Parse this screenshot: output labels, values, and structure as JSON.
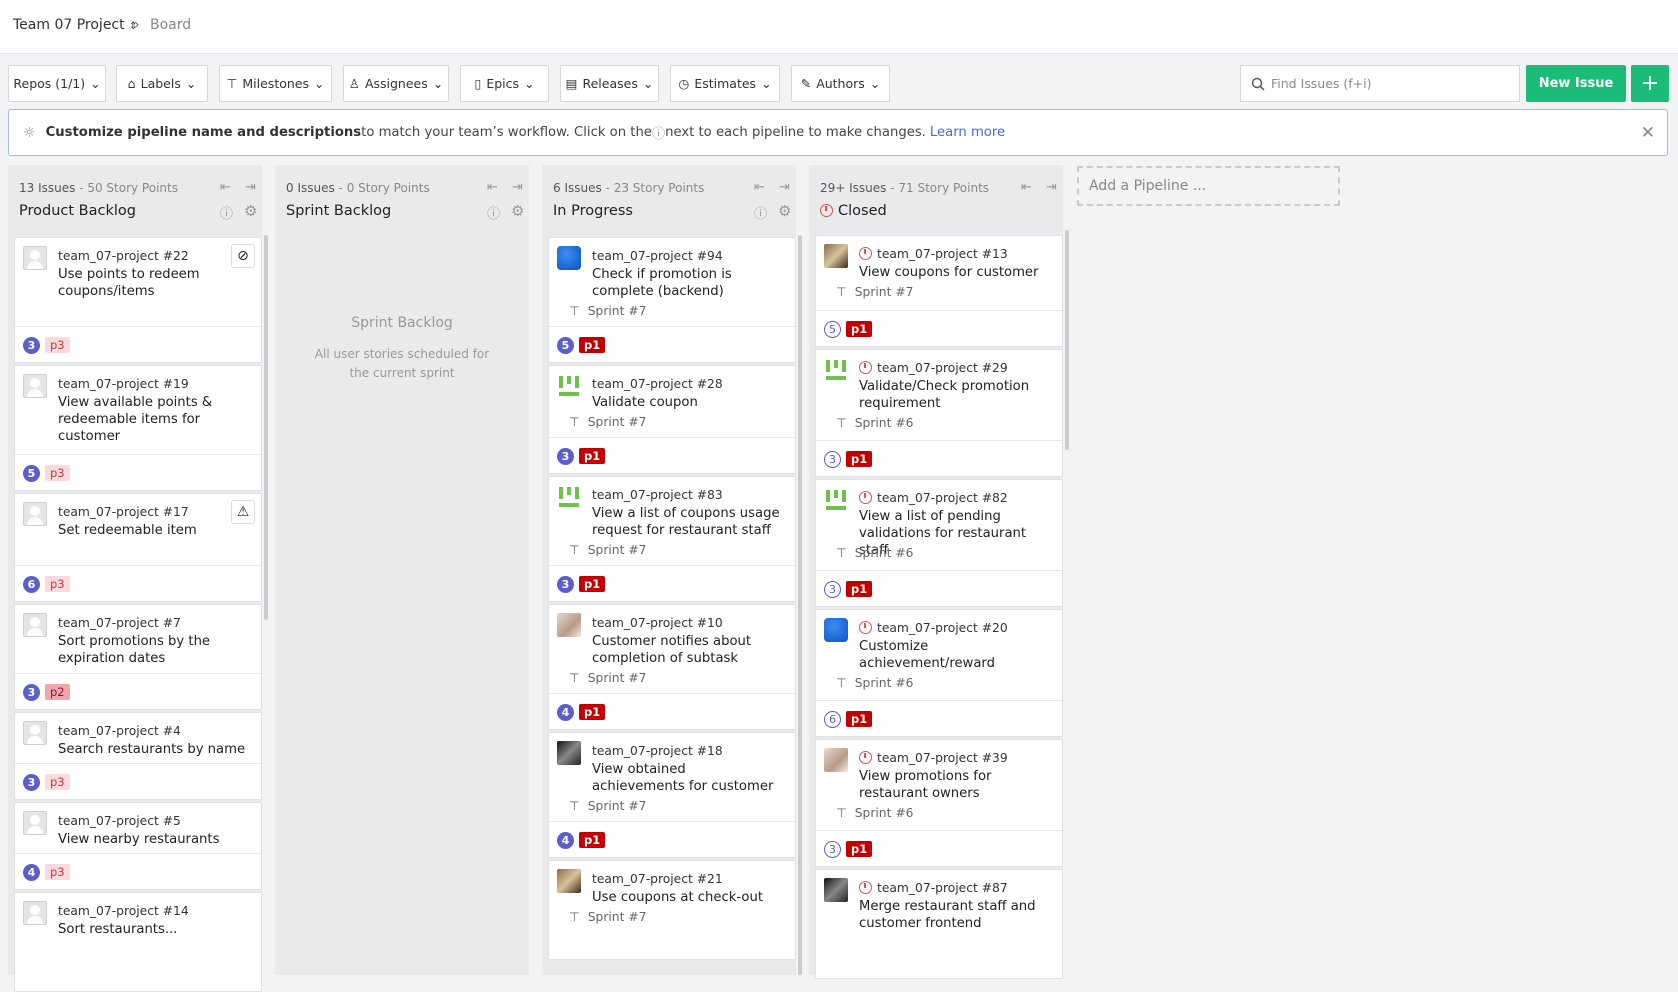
{
  "breadcrumb": {
    "project": "Team 07 Project",
    "page": "Board"
  },
  "toolbar": {
    "filters": [
      "Repos (1/1)",
      "Labels",
      "Milestones",
      "Assignees",
      "Epics",
      "Releases",
      "Estimates",
      "Authors"
    ],
    "search_placeholder": "Find Issues (f+i)",
    "new_issue": "New Issue",
    "plus": "+"
  },
  "banner": {
    "bold": "Customize pipeline name and descriptions",
    "text1": " to match your team’s workflow. Click on the ",
    "text2": " next to each pipeline to make changes.",
    "link": "Learn more"
  },
  "pipelines": [
    {
      "count": "13 Issues",
      "points": " - 50 Story Points",
      "name": "Product Backlog"
    },
    {
      "count": "0 Issues",
      "points": " - 0 Story Points",
      "name": "Sprint Backlog"
    },
    {
      "count": "6 Issues",
      "points": " - 23 Story Points",
      "name": "In Progress"
    },
    {
      "count": "29+ Issues",
      "points": " - 71 Story Points",
      "name": "Closed"
    }
  ],
  "sprint_backlog_empty": {
    "title": "Sprint Backlog",
    "desc": "All user stories scheduled for the current sprint"
  },
  "add_pipeline": "Add a Pipeline ...",
  "backlog_cards": [
    {
      "repo": "team_07-project #22",
      "title": "Use points to redeem coupons/items",
      "estimate": "3",
      "label": "p3"
    },
    {
      "repo": "team_07-project #19",
      "title": "View available points & redeemable items for customer",
      "estimate": "5",
      "label": "p3"
    },
    {
      "repo": "team_07-project #17",
      "title": "Set redeemable item",
      "estimate": "6",
      "label": "p3"
    },
    {
      "repo": "team_07-project #7",
      "title": "Sort promotions by the expiration dates",
      "estimate": "3",
      "label": "p2"
    },
    {
      "repo": "team_07-project #4",
      "title": "Search restaurants by name",
      "estimate": "3",
      "label": "p3"
    },
    {
      "repo": "team_07-project #5",
      "title": "View nearby restaurants",
      "estimate": "4",
      "label": "p3"
    },
    {
      "repo": "team_07-project #14",
      "title": "Sort restaurants..."
    }
  ],
  "progress_cards": [
    {
      "repo": "team_07-project #94",
      "title": "Check if promotion is complete (backend)",
      "sprint": "Sprint #7",
      "estimate": "5",
      "label": "p1"
    },
    {
      "repo": "team_07-project #28",
      "title": "Validate coupon",
      "sprint": "Sprint #7",
      "estimate": "3",
      "label": "p1"
    },
    {
      "repo": "team_07-project #83",
      "title": "View a list of coupons usage request for restaurant staff",
      "sprint": "Sprint #7",
      "estimate": "3",
      "label": "p1"
    },
    {
      "repo": "team_07-project #10",
      "title": "Customer notifies about completion of subtask",
      "sprint": "Sprint #7",
      "estimate": "4",
      "label": "p1"
    },
    {
      "repo": "team_07-project #18",
      "title": "View obtained achievements for customer",
      "sprint": "Sprint #7",
      "estimate": "4",
      "label": "p1"
    },
    {
      "repo": "team_07-project #21",
      "title": "Use coupons at check-out",
      "sprint": "Sprint #7"
    }
  ],
  "closed_cards": [
    {
      "repo": "team_07-project #13",
      "title": "View coupons for customer",
      "sprint": "Sprint #7",
      "estimate": "5",
      "label": "p1"
    },
    {
      "repo": "team_07-project #29",
      "title": "Validate/Check promotion requirement",
      "sprint": "Sprint #6",
      "estimate": "3",
      "label": "p1"
    },
    {
      "repo": "team_07-project #82",
      "title": "View a list of pending validations for restaurant staff",
      "sprint": "Sprint #6",
      "estimate": "3",
      "label": "p1"
    },
    {
      "repo": "team_07-project #20",
      "title": "Customize achievement/reward",
      "sprint": "Sprint #6",
      "estimate": "6",
      "label": "p1"
    },
    {
      "repo": "team_07-project #39",
      "title": "View promotions for restaurant owners",
      "sprint": "Sprint #6",
      "estimate": "3",
      "label": "p1"
    },
    {
      "repo": "team_07-project #87",
      "title": "Merge restaurant staff and customer frontend"
    }
  ],
  "colors": {
    "accent": "#1bbc78",
    "estimate": "#5b5fc7",
    "p1": "#c20000",
    "p3": "#fdd8dc",
    "link": "#3f6cd9"
  }
}
